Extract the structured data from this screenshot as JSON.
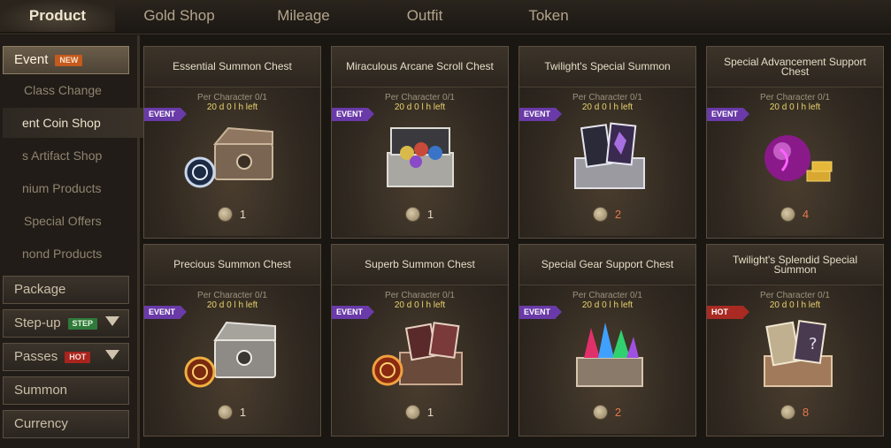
{
  "top_tabs": [
    "Product",
    "Gold Shop",
    "Mileage",
    "Outfit",
    "Token"
  ],
  "sidebar": {
    "event": {
      "label": "Event",
      "tag": "NEW"
    },
    "sub_items": [
      "Class Change",
      "ent Coin Shop",
      "s Artifact Shop",
      "nium Products",
      "Special Offers",
      "nond Products"
    ],
    "package": "Package",
    "stepup": {
      "label": "Step-up",
      "tag": "STEP"
    },
    "passes": {
      "label": "Passes",
      "tag": "HOT"
    },
    "summon": "Summon",
    "currency": "Currency"
  },
  "cards": [
    {
      "title": "Essential Summon Chest",
      "per": "Per Character 0/1",
      "left": "20 d 0 l h left",
      "badge": "EVENT",
      "price": "1",
      "icon": "chest-icon"
    },
    {
      "title": "Miraculous Arcane Scroll Chest",
      "per": "Per Character 0/1",
      "left": "20 d 0 l h left",
      "badge": "EVENT",
      "price": "1",
      "icon": "scroll-chest-icon"
    },
    {
      "title": "Twilight's Special Summon",
      "per": "Per Character 0/1",
      "left": "20 d 0 l h left",
      "badge": "EVENT",
      "price": "2",
      "icon": "card-chest-icon"
    },
    {
      "title": "Special Advancement Support Chest",
      "per": "Per Character 0/1",
      "left": "20 d 0 l h left",
      "badge": "EVENT",
      "price": "4",
      "icon": "orb-gold-icon"
    },
    {
      "title": "Precious Summon Chest",
      "per": "Per Character 0/1",
      "left": "20 d 0 l h left",
      "badge": "EVENT",
      "price": "1",
      "icon": "chest-icon"
    },
    {
      "title": "Superb Summon Chest",
      "per": "Per Character 0/1",
      "left": "20 d 0 l h left",
      "badge": "EVENT",
      "price": "1",
      "icon": "card-chest-icon"
    },
    {
      "title": "Special Gear Support Chest",
      "per": "Per Character 0/1",
      "left": "20 d 0 l h left",
      "badge": "EVENT",
      "price": "2",
      "icon": "gem-chest-icon"
    },
    {
      "title": "Twilight's Splendid Special Summon",
      "per": "Per Character 0/1",
      "left": "20 d 0 l h left",
      "badge": "HOT",
      "price": "8",
      "icon": "card-chest-icon"
    }
  ]
}
